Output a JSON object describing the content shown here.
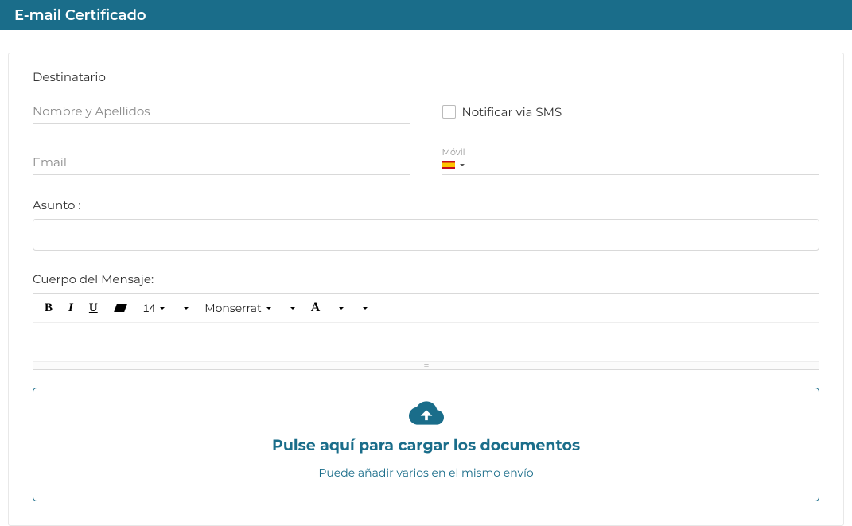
{
  "header": {
    "title": "E-mail Certificado"
  },
  "recipient": {
    "section_label": "Destinatario",
    "name_placeholder": "Nombre y Apellidos",
    "email_placeholder": "Email",
    "notify_sms_label": "Notificar via SMS",
    "mobile_label": "Móvil",
    "country_flag": "es"
  },
  "subject": {
    "label": "Asunto :",
    "value": ""
  },
  "message": {
    "label": "Cuerpo del Mensaje:",
    "toolbar": {
      "font_size": "14",
      "font_name": "Monserrat"
    }
  },
  "dropzone": {
    "title": "Pulse aquí para cargar los documentos",
    "subtitle": "Puede añadir varios en el mismo envío"
  }
}
